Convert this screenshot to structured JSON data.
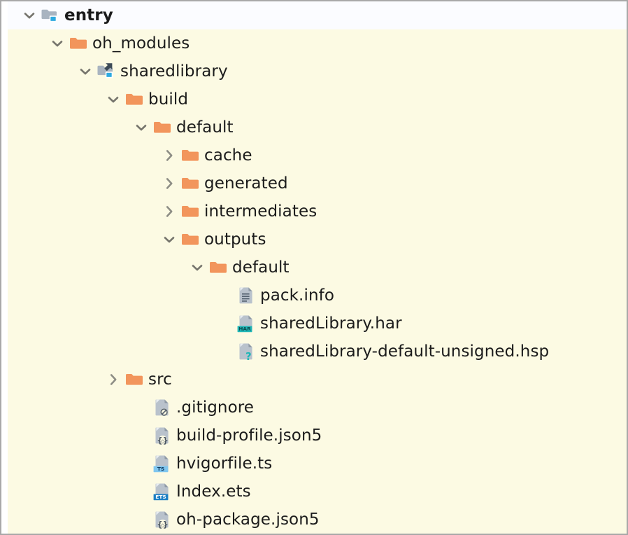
{
  "panel": {
    "name": "project-file-tree",
    "background_color": "#fcfae3",
    "selected_row_color": "#fbfcff",
    "border_color": "#a8a8a8",
    "folder_color": "#f2955c",
    "module_folder_color": "#a9b4c0",
    "badge_blue": "#2eaae0",
    "doc_gray": "#b9c2cc",
    "har_band_color": "#1fb6b6",
    "ts_band_color": "#7fc6ef",
    "ets_band_color": "#1b7fc4",
    "text_color": "#1b1b1b"
  },
  "tree": {
    "nodes": [
      {
        "id": "entry",
        "label": "entry",
        "depth": 0,
        "type": "folder",
        "icon": "module-folder-icon",
        "state": "expanded",
        "twisty": "chevron-down-icon",
        "selected": true,
        "bold": true
      },
      {
        "id": "oh_modules",
        "label": "oh_modules",
        "depth": 1,
        "type": "folder",
        "icon": "folder-icon",
        "state": "expanded",
        "twisty": "chevron-down-icon",
        "selected": false,
        "bold": false
      },
      {
        "id": "sharedlibrary",
        "label": "sharedlibrary",
        "depth": 2,
        "type": "folder",
        "icon": "symlink-module-folder-icon",
        "state": "expanded",
        "twisty": "chevron-down-icon",
        "selected": false,
        "bold": false
      },
      {
        "id": "build",
        "label": "build",
        "depth": 3,
        "type": "folder",
        "icon": "folder-icon",
        "state": "expanded",
        "twisty": "chevron-down-icon",
        "selected": false,
        "bold": false
      },
      {
        "id": "build-default",
        "label": "default",
        "depth": 4,
        "type": "folder",
        "icon": "folder-icon",
        "state": "expanded",
        "twisty": "chevron-down-icon",
        "selected": false,
        "bold": false
      },
      {
        "id": "cache",
        "label": "cache",
        "depth": 5,
        "type": "folder",
        "icon": "folder-icon",
        "state": "collapsed",
        "twisty": "chevron-right-icon",
        "selected": false,
        "bold": false
      },
      {
        "id": "generated",
        "label": "generated",
        "depth": 5,
        "type": "folder",
        "icon": "folder-icon",
        "state": "collapsed",
        "twisty": "chevron-right-icon",
        "selected": false,
        "bold": false
      },
      {
        "id": "intermediates",
        "label": "intermediates",
        "depth": 5,
        "type": "folder",
        "icon": "folder-icon",
        "state": "collapsed",
        "twisty": "chevron-right-icon",
        "selected": false,
        "bold": false
      },
      {
        "id": "outputs",
        "label": "outputs",
        "depth": 5,
        "type": "folder",
        "icon": "folder-icon",
        "state": "expanded",
        "twisty": "chevron-down-icon",
        "selected": false,
        "bold": false
      },
      {
        "id": "outputs-default",
        "label": "default",
        "depth": 6,
        "type": "folder",
        "icon": "folder-icon",
        "state": "expanded",
        "twisty": "chevron-down-icon",
        "selected": false,
        "bold": false
      },
      {
        "id": "pack-info",
        "label": "pack.info",
        "depth": 7,
        "type": "file",
        "icon": "text-file-icon",
        "state": "leaf",
        "twisty": "none",
        "selected": false,
        "bold": false
      },
      {
        "id": "sharedlibrary-har",
        "label": "sharedLibrary.har",
        "depth": 7,
        "type": "file",
        "icon": "har-file-icon",
        "badge_text": "HAR",
        "state": "leaf",
        "twisty": "none",
        "selected": false,
        "bold": false
      },
      {
        "id": "sharedlibrary-hsp",
        "label": "sharedLibrary-default-unsigned.hsp",
        "depth": 7,
        "type": "file",
        "icon": "unknown-file-icon",
        "state": "leaf",
        "twisty": "none",
        "selected": false,
        "bold": false
      },
      {
        "id": "src",
        "label": "src",
        "depth": 3,
        "type": "folder",
        "icon": "folder-icon",
        "state": "collapsed",
        "twisty": "chevron-right-icon",
        "selected": false,
        "bold": false
      },
      {
        "id": "gitignore",
        "label": ".gitignore",
        "depth": 4,
        "type": "file",
        "icon": "gitignore-file-icon",
        "state": "leaf",
        "twisty": "none",
        "selected": false,
        "bold": false
      },
      {
        "id": "build-profile-json5",
        "label": "build-profile.json5",
        "depth": 4,
        "type": "file",
        "icon": "json-file-icon",
        "state": "leaf",
        "twisty": "none",
        "selected": false,
        "bold": false
      },
      {
        "id": "hvigorfile-ts",
        "label": "hvigorfile.ts",
        "depth": 4,
        "type": "file",
        "icon": "ts-file-icon",
        "badge_text": "TS",
        "state": "leaf",
        "twisty": "none",
        "selected": false,
        "bold": false
      },
      {
        "id": "index-ets",
        "label": "Index.ets",
        "depth": 4,
        "type": "file",
        "icon": "ets-file-icon",
        "badge_text": "ETS",
        "state": "leaf",
        "twisty": "none",
        "selected": false,
        "bold": false
      },
      {
        "id": "oh-package-json5",
        "label": "oh-package.json5",
        "depth": 4,
        "type": "file",
        "icon": "json-file-icon",
        "state": "leaf",
        "twisty": "none",
        "selected": false,
        "bold": false
      }
    ]
  }
}
